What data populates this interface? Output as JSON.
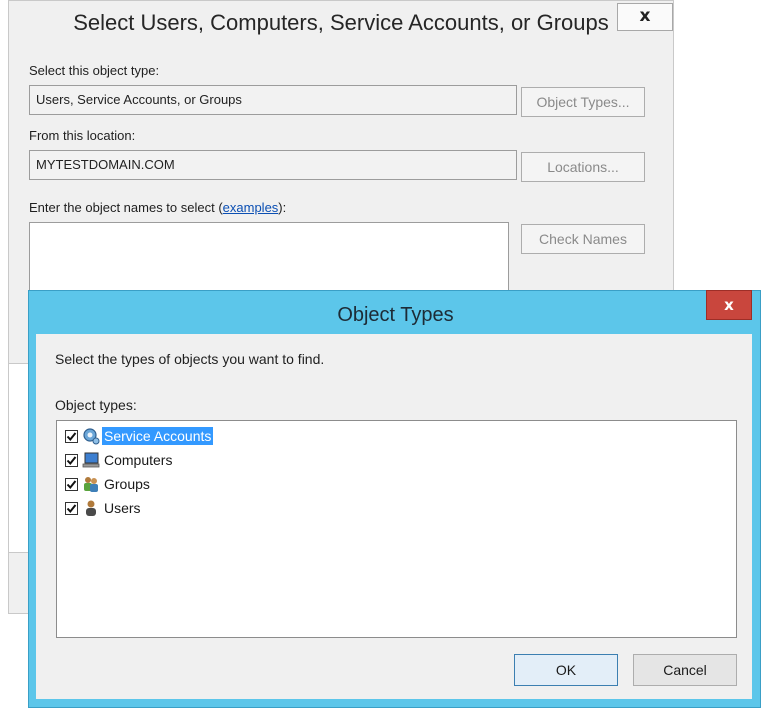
{
  "select_dialog": {
    "title": "Select Users, Computers, Service Accounts, or Groups",
    "close_glyph": "x",
    "object_type_label": "Select this object type:",
    "object_type_value": "Users, Service Accounts, or Groups",
    "object_types_button": "Object Types...",
    "location_label": "From this location:",
    "location_value": "MYTESTDOMAIN.COM",
    "locations_button": "Locations...",
    "names_label_prefix": "Enter the object names to select (",
    "names_label_link": "examples",
    "names_label_suffix": "):",
    "check_names_button": "Check Names"
  },
  "object_types_dialog": {
    "title": "Object Types",
    "close_glyph": "x",
    "instruction": "Select the types of objects you want to find.",
    "list_label": "Object types:",
    "items": [
      {
        "label": "Service Accounts",
        "checked": true,
        "selected": true,
        "icon": "service-account-icon"
      },
      {
        "label": "Computers",
        "checked": true,
        "selected": false,
        "icon": "computer-icon"
      },
      {
        "label": "Groups",
        "checked": true,
        "selected": false,
        "icon": "group-icon"
      },
      {
        "label": "Users",
        "checked": true,
        "selected": false,
        "icon": "user-icon"
      }
    ],
    "ok_button": "OK",
    "cancel_button": "Cancel"
  }
}
